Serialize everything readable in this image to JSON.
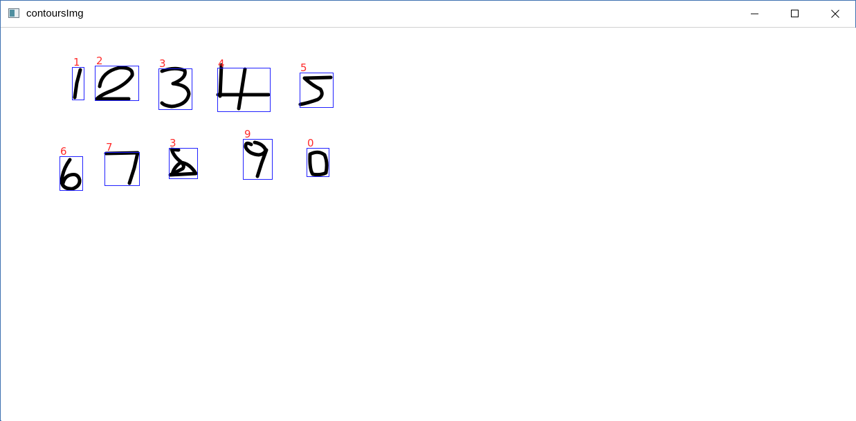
{
  "window": {
    "title": "contoursImg",
    "icons": {
      "app": "opencv-window-icon",
      "minimize": "minimize-icon",
      "maximize": "maximize-icon",
      "close": "close-icon"
    }
  },
  "canvas": {
    "box_color": "#1f1fff",
    "label_color": "#ff2a2a",
    "stroke_color": "#000000",
    "detections": [
      {
        "label": "1",
        "glyph": "1"
      },
      {
        "label": "2",
        "glyph": "2"
      },
      {
        "label": "3",
        "glyph": "3"
      },
      {
        "label": "4",
        "glyph": "4"
      },
      {
        "label": "5",
        "glyph": "5"
      },
      {
        "label": "6",
        "glyph": "6"
      },
      {
        "label": "7",
        "glyph": "7"
      },
      {
        "label": "3",
        "glyph": "8"
      },
      {
        "label": "9",
        "glyph": "9"
      },
      {
        "label": "0",
        "glyph": "0"
      }
    ]
  }
}
